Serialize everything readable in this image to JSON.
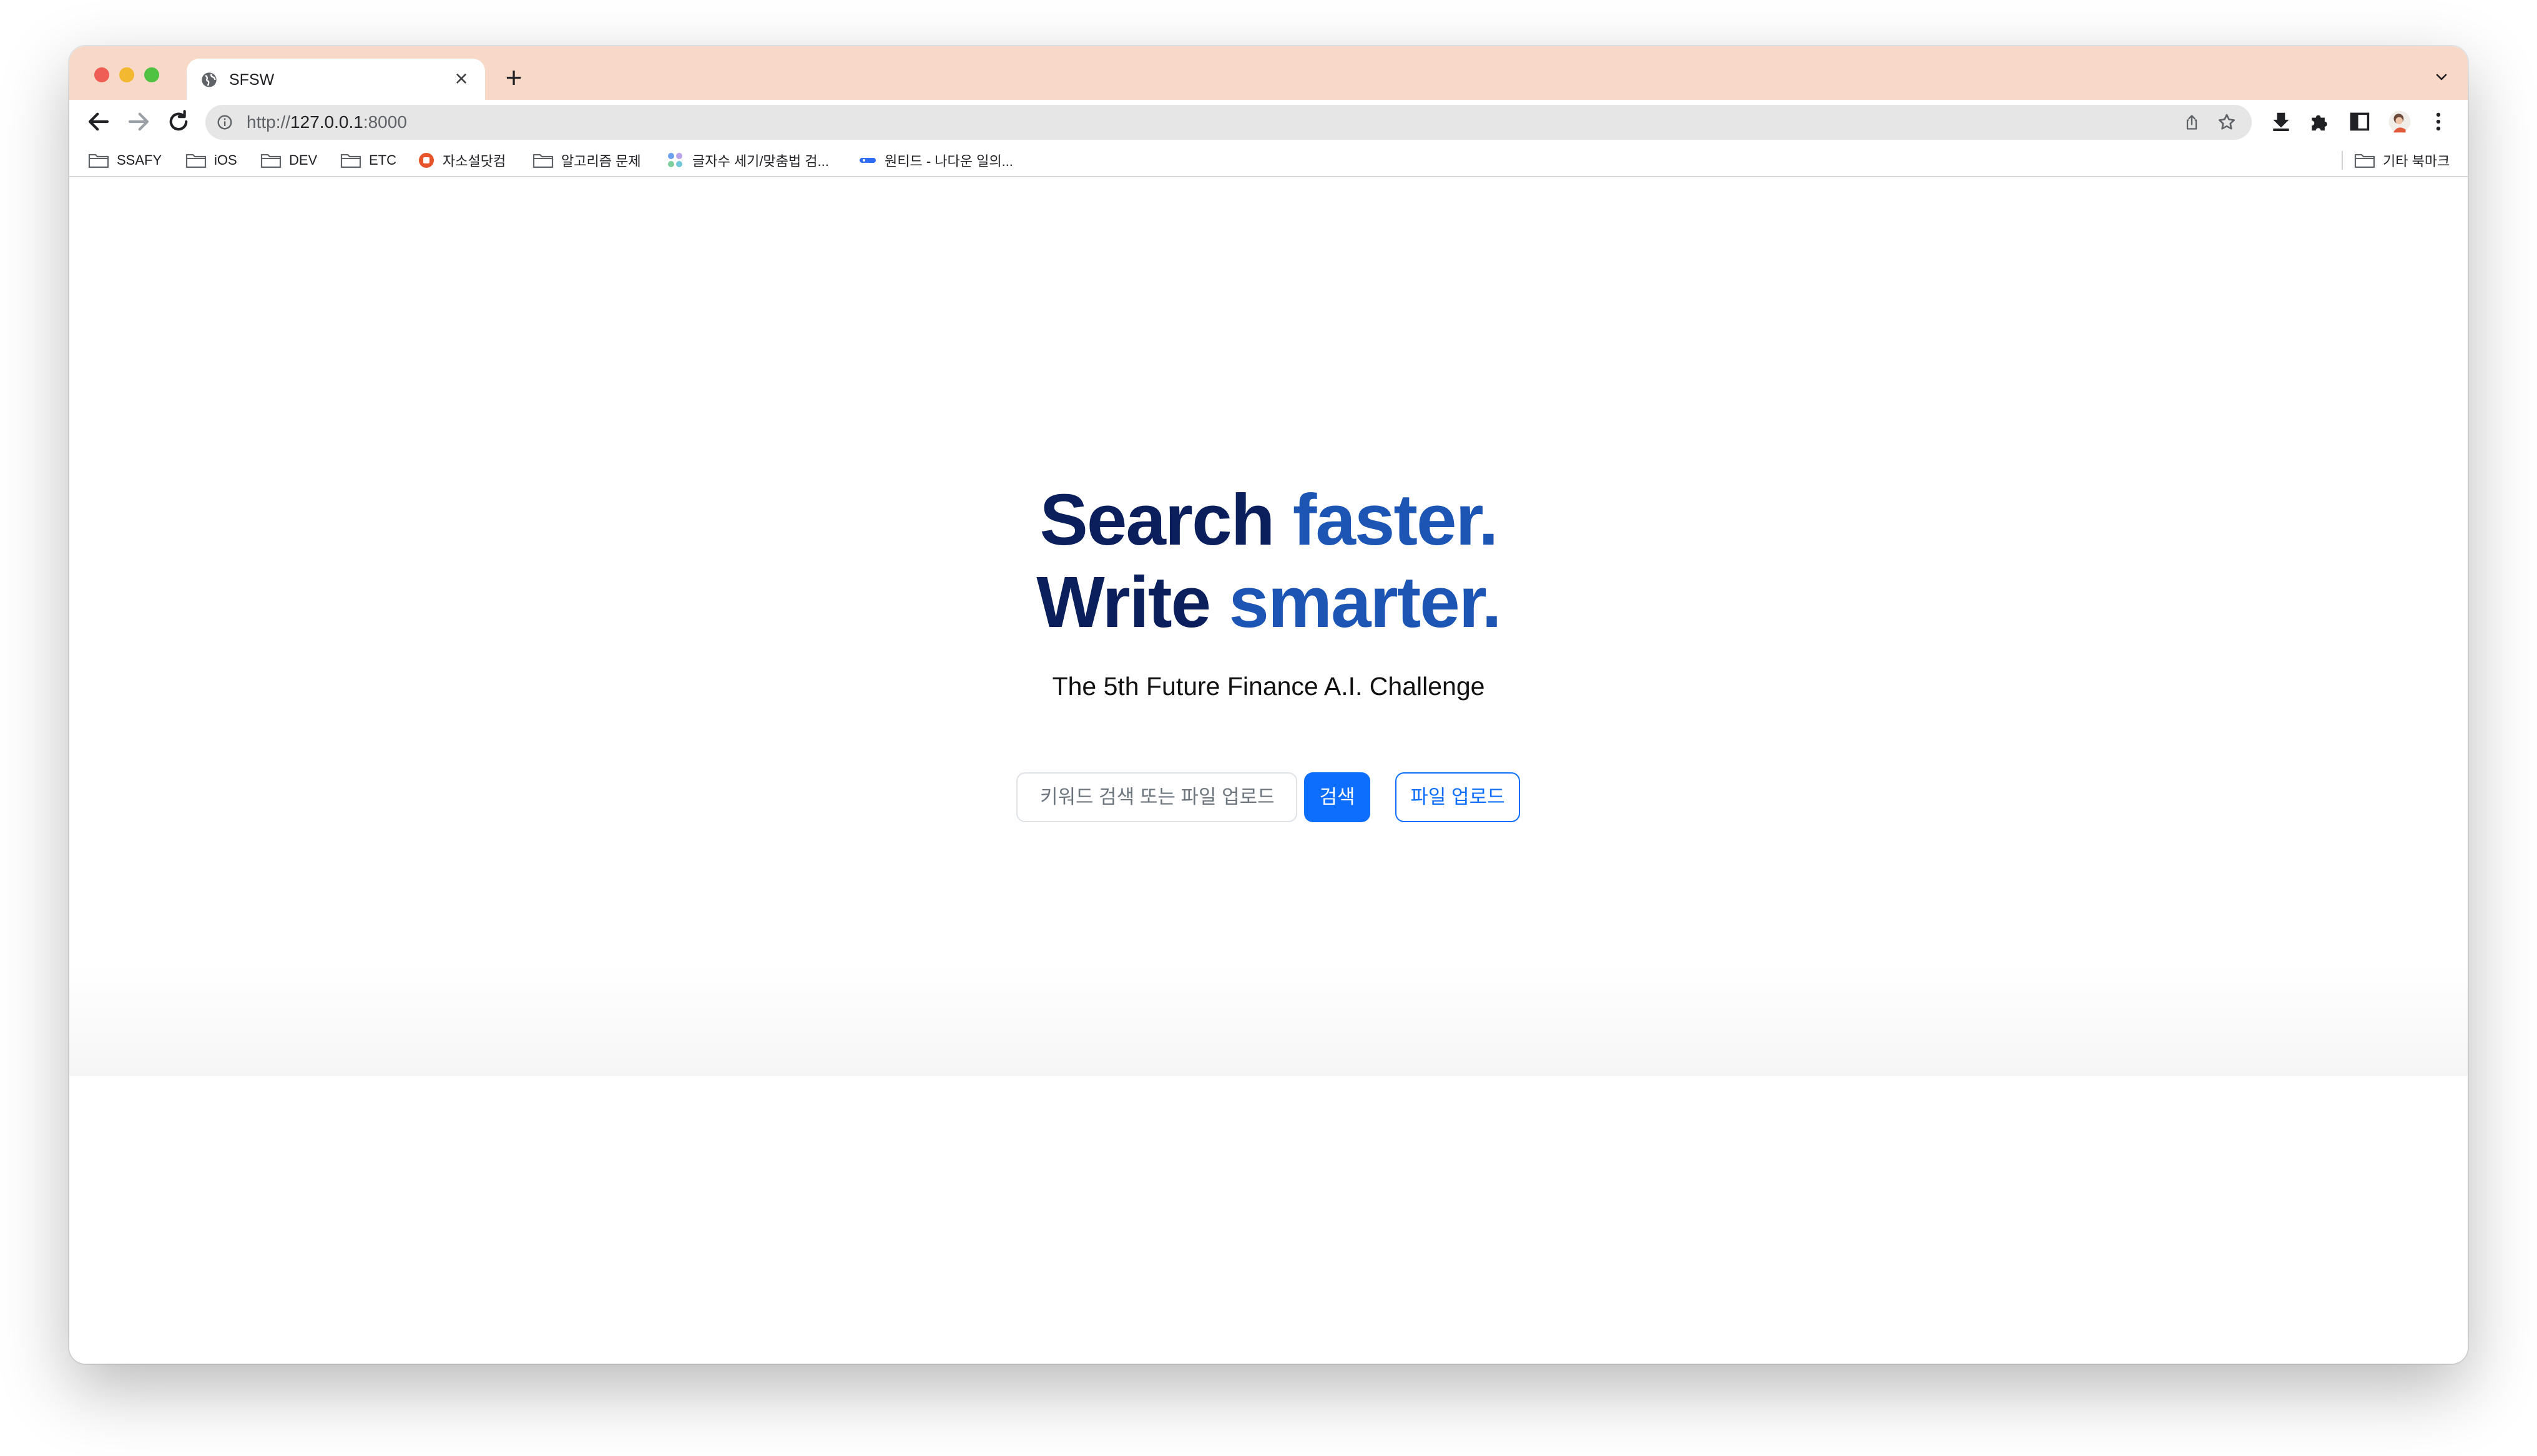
{
  "browser": {
    "tab": {
      "title": "SFSW",
      "favicon": "globe-icon",
      "close_glyph": "×"
    },
    "new_tab_glyph": "+",
    "address": {
      "scheme": "http://",
      "host": "127.0.0.1",
      "port": ":8000"
    },
    "bookmarks": [
      {
        "label": "SSAFY",
        "icon": "folder-icon"
      },
      {
        "label": "iOS",
        "icon": "folder-icon"
      },
      {
        "label": "DEV",
        "icon": "folder-icon"
      },
      {
        "label": "ETC",
        "icon": "folder-icon"
      },
      {
        "label": "자소설닷컴",
        "icon": "site-favicon-icon"
      },
      {
        "label": "알고리즘 문제",
        "icon": "folder-icon"
      },
      {
        "label": "글자수 세기/맞춤법 검...",
        "icon": "site-favicon-icon"
      },
      {
        "label": "원티드 - 나다운 일의...",
        "icon": "site-favicon-icon"
      }
    ],
    "other_bookmarks": "기타 북마크"
  },
  "hero": {
    "line1_dark": "Search",
    "line1_accent": "faster.",
    "line2_dark": "Write",
    "line2_accent": "smarter.",
    "subtitle": "The 5th Future Finance A.I. Challenge"
  },
  "search": {
    "placeholder": "키워드 검색 또는 파일 업로드",
    "value": "",
    "search_button": "검색",
    "upload_button": "파일 업로드"
  },
  "colors": {
    "tabstrip": "#f8d8c6",
    "headline_dark": "#0a1f5c",
    "headline_accent": "#1c55b3",
    "primary": "#0d6efd"
  }
}
